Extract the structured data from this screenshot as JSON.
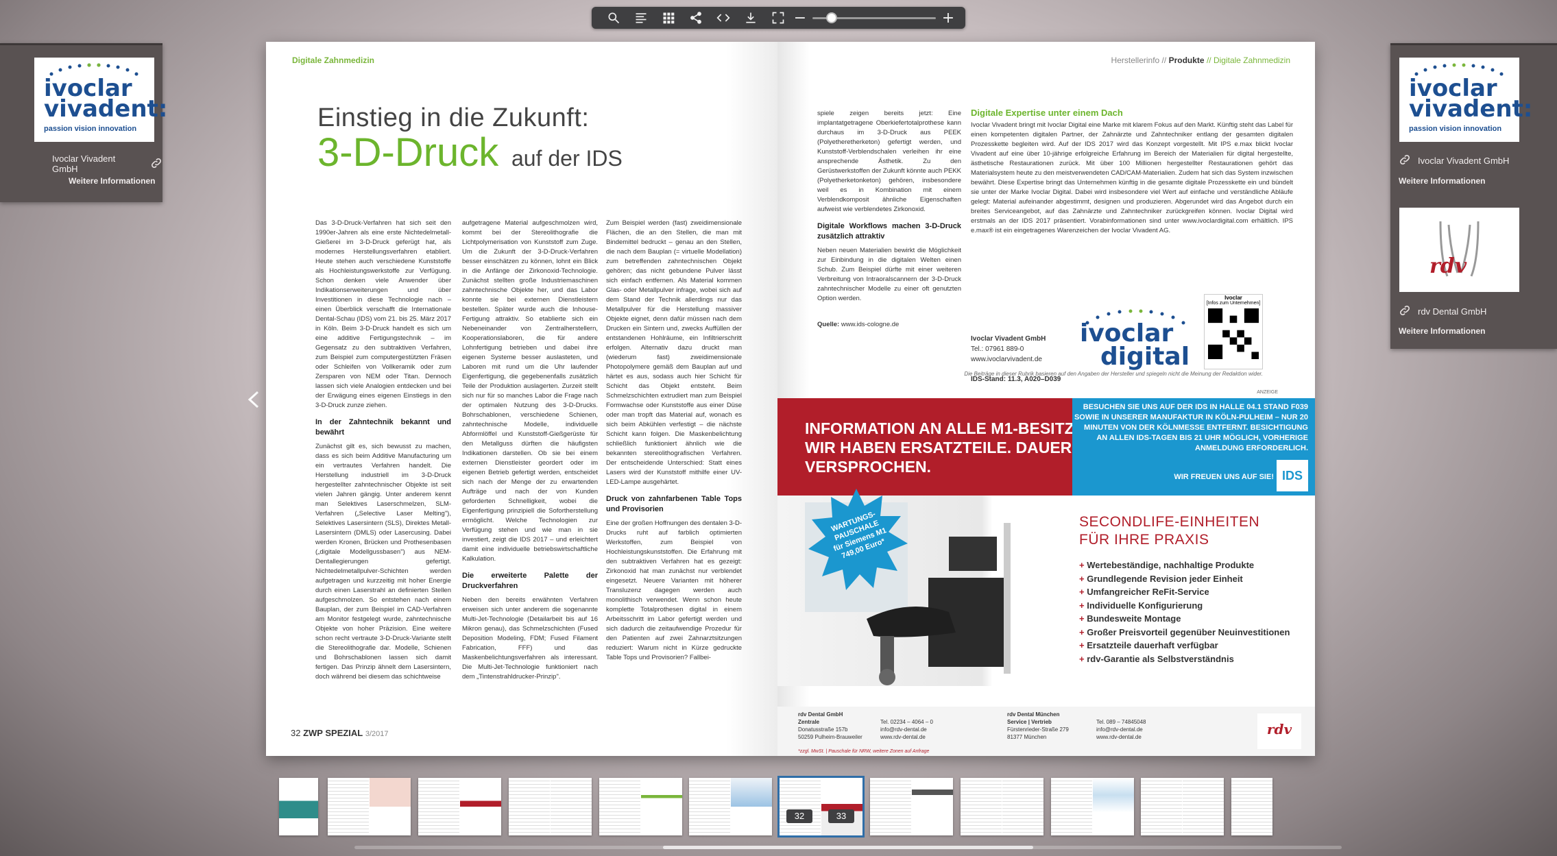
{
  "toolbar": {
    "icons": [
      "search-icon",
      "table-of-contents-icon",
      "grid-icon",
      "share-icon",
      "embed-icon",
      "download-icon",
      "fullscreen-icon"
    ],
    "zoom_minus": "−",
    "zoom_plus": "+"
  },
  "left_panel": {
    "company": "Ivoclar Vivadent GmbH",
    "more_info": "Weitere Informationen",
    "logo_line1": "ivoclar",
    "logo_line2": "vivadent:",
    "logo_tagline": "passion vision innovation"
  },
  "right_panel": {
    "items": [
      {
        "company": "Ivoclar Vivadent GmbH",
        "more_info": "Weitere Informationen",
        "logo_line1": "ivoclar",
        "logo_line2": "vivadent:",
        "logo_tagline": "passion vision innovation"
      },
      {
        "company": "rdv Dental GmbH",
        "more_info": "Weitere Informationen",
        "logo_text": "rdv"
      }
    ]
  },
  "left_page": {
    "section": "Digitale Zahnmedizin",
    "title_line1": "Einstieg in die Zukunft:",
    "title_big": "3-D-Druck",
    "title_rest": "auf der IDS",
    "col1_p1": "Das 3-D-Druck-Verfahren hat sich seit den 1990er-Jahren als eine erste Nichtedelmetall-Gießerei im 3-D-Druck geferügt hat, als modernes Herstellungsverfahren etabliert. Heute stehen auch verschiedene Kunststoffe als Hochleistungswerkstoffe zur Verfügung. Schon denken viele Anwender über Indikationserweiterungen und über Investitionen in diese Technologie nach – einen Überblick verschafft die Internationale Dental-Schau (IDS) vom 21. bis 25. März 2017 in Köln. Beim 3-D-Druck handelt es sich um eine additive Fertigungstechnik – im Gegensatz zu den subtraktiven Verfahren, zum Beispiel zum computergestützten Fräsen oder Schleifen von Vollkeramik oder zum Zersparen von NEM oder Titan. Dennoch lassen sich viele Analogien entdecken und bei der Erwägung eines eigenen Einstiegs in den 3-D-Druck zunze ziehen.",
    "col1_sub": "In der Zahntechnik bekannt und bewährt",
    "col1_p2": "Zunächst gilt es, sich bewusst zu machen, dass es sich beim Additive Manufacturing um ein vertrautes Verfahren handelt. Die Herstellung industriell im 3-D-Druck hergestellter zahntechnischer Objekte ist seit vielen Jahren gängig. Unter anderem kennt man Selektives Laserschmelzen, SLM-Verfahren („Selective Laser Melting\"), Selektives Lasersintern (SLS), Direktes Metall-Lasersintern (DMLS) oder Lasercusing. Dabei werden Kronen, Brücken und Prothesenbasen („digitale Modellgussbasen\") aus NEM-Dentallegierungen gefertigt. Nichtedelmetallpulver-Schichten werden aufgetragen und kurzzeitig mit hoher Energie durch einen Laserstrahl an definierten Stellen aufgeschmolzen. So entstehen nach einem Bauplan, der zum Beispiel im CAD-Verfahren am Monitor festgelegt wurde, zahntechnische Objekte von hoher Präzision. Eine weitere schon recht vertraute 3-D-Druck-Variante stellt die Stereolithografie dar. Modelle, Schienen und Bohrschablonen lassen sich damit fertigen. Das Prinzip ähnelt dem Lasersintern, doch während bei diesem das schichtweise",
    "col2_p1": "aufgetragene Material aufgeschmolzen wird, kommt bei der Stereolithografie die Lichtpolymerisation von Kunststoff zum Zuge. Um die Zukunft der 3-D-Druck-Verfahren besser einschätzen zu können, lohnt ein Blick in die Anfänge der Zirkonoxid-Technologie. Zunächst stellten große Industriemaschinen zahntechnische Objekte her, und das Labor konnte sie bei externen Dienstleistern bestellen. Später wurde auch die Inhouse-Fertigung attraktiv. So etablierte sich ein Nebeneinander von Zentralherstellern, Kooperationslaboren, die für andere Lohnfertigung betrieben und dabei ihre eigenen Systeme besser auslasteten, und Laboren mit rund um die Uhr laufender Eigenfertigung, die gegebenenfalls zusätzlich Teile der Produktion auslagerten. Zurzeit stellt sich nur für so manches Labor die Frage nach der optimalen Nutzung des 3-D-Drucks. Bohrschablonen, verschiedene Schienen, zahntechnische Modelle, individuelle Abformlöffel und Kunststoff-Gießgerüste für den Metallguss dürften die häufigsten Indikationen darstellen. Ob sie bei einem externen Dienstleister geordert oder im eigenen Betrieb gefertigt werden, entscheidet sich nach der Menge der zu erwartenden Aufträge und nach der von Kunden geforderten Schnelligkeit, wobei die Eigenfertigung prinzipiell die Sofortherstellung ermöglicht. Welche Technologien zur Verfügung stehen und wie man in sie investiert, zeigt die IDS 2017 – und erleichtert damit eine individuelle betriebswirtschaftliche Kalkulation.",
    "col2_sub": "Die erweiterte Palette der Druckverfahren",
    "col2_p2": "Neben den bereits erwähnten Verfahren erweisen sich unter anderem die sogenannte Multi-Jet-Technologie (Detailarbeit bis auf 16 Mikron genau), das Schmelzschichten (Fused Deposition Modeling, FDM; Fused Filament Fabrication, FFF) und das Maskenbelichtungsverfahren als interessant. Die Multi-Jet-Technologie funktioniert nach dem „Tintenstrahldrucker-Prinzip\".",
    "col3_p1": "Zum Beispiel werden (fast) zweidimensionale Flächen, die an den Stellen, die man mit Bindemittel bedruckt – genau an den Stellen, die nach dem Bauplan (= virtuelle Modellation) zum betreffenden zahntechnischen Objekt gehören; das nicht gebundene Pulver lässt sich einfach entfernen. Als Material kommen Glas- oder Metallpulver infrage, wobei sich auf dem Stand der Technik allerdings nur das Metallpulver für die Herstellung massiver Objekte eignet, denn dafür müssen nach dem Drucken ein Sintern und, zwecks Auffüllen der entstandenen Hohlräume, ein Infiltrierschritt erfolgen. Alternativ dazu druckt man (wiederum fast) zweidimensionale Photopolymere gemäß dem Bauplan auf und härtet es aus, sodass auch hier Schicht für Schicht das Objekt entsteht. Beim Schmelzschichten extrudiert man zum Beispiel Formwachse oder Kunststoffe aus einer Düse oder man tropft das Material auf, wonach es sich beim Abkühlen verfestigt – die nächste Schicht kann folgen. Die Maskenbelichtung schließlich funktioniert ähnlich wie die bekannten stereolithografischen Verfahren. Der entscheidende Unterschied: Statt eines Lasers wird der Kunststoff mithilfe einer UV-LED-Lampe ausgehärtet.",
    "col3_sub": "Druck von zahnfarbenen Table Tops und Provisorien",
    "col3_p2": "Eine der großen Hoffnungen des dentalen 3-D-Drucks ruht auf farblich optimierten Werkstoffen, zum Beispiel von Hochleistungskunststoffen. Die Erfahrung mit den subtraktiven Verfahren hat es gezeigt: Zirkonoxid hat man zunächst nur verblendet eingesetzt. Neuere Varianten mit höherer Transluzenz dagegen werden auch monolithisch verwendet. Wenn schon heute komplette Totalprothesen digital in einem Arbeitsschritt im Labor gefertigt werden und sich dadurch die zeitaufwendige Prozedur für den Patienten auf zwei Zahnarztsitzungen reduziert: Warum nicht in Kürze gedruckte Table Tops und Provisorien? Fallbei-",
    "footer_page": "32",
    "footer_mag": "ZWP SPEZIAL",
    "footer_issue": "3/2017"
  },
  "right_page": {
    "header_pre": "Herstellerinfo //",
    "header_bold": "Produkte",
    "header_post": "// Digitale Zahnmedizin",
    "col1_p1": "spiele zeigen bereits jetzt: Eine implantatgetragene Oberkiefertotalprothese kann durchaus im 3-D-Druck aus PEEK (Polyetheretherketon) gefertigt werden, und Kunststoff-Verblendschalen verleihen ihr eine ansprechende Ästhetik. Zu den Gerüstwerkstoffen der Zukunft könnte auch PEKK (Polyetherketonketon) gehören, insbesondere weil es in Kombination mit einem Verblendkomposit ähnliche Eigenschaften aufweist wie verblendetes Zirkonoxid.",
    "col1_sub": "Digitale Workflows machen 3-D-Druck zusätzlich attraktiv",
    "col1_p2": "Neben neuen Materialien bewirkt die Möglichkeit zur Einbindung in die digitalen Welten einen Schub. Zum Beispiel dürfte mit einer weiteren Verbreitung von Intraoralscannern der 3-D-Druck zahntechnischer Modelle zu einer oft genutzten Option werden.",
    "source_label": "Quelle:",
    "source": "www.ids-cologne.de",
    "box_title": "Digitale Expertise unter einem Dach",
    "box_p": "Ivoclar Vivadent bringt mit Ivoclar Digital eine Marke mit klarem Fokus auf den Markt. Künftig steht das Label für einen kompetenten digitalen Partner, der Zahnärzte und Zahntechniker entlang der gesamten digitalen Prozesskette begleiten wird. Auf der IDS 2017 wird das Konzept vorgestellt. Mit IPS e.max blickt Ivoclar Vivadent auf eine über 10-jährige erfolgreiche Erfahrung im Bereich der Materialien für digital hergestellte, ästhetische Restaurationen zurück. Mit über 100 Millionen hergestellter Restaurationen gehört das Materialsystem heute zu den meistverwendeten CAD/CAM-Materialien. Zudem hat sich das System inzwischen bewährt. Diese Expertise bringt das Unternehmen künftig in die gesamte digitale Prozesskette ein und bündelt sie unter der Marke Ivoclar Digital. Dabei wird insbesondere viel Wert auf einfache und verständliche Abläufe gelegt: Material aufeinander abgestimmt, designen und produzieren. Abgerundet wird das Angebot durch ein breites Serviceangebot, auf das Zahnärzte und Zahntechniker zurückgreifen können. Ivoclar Digital wird erstmals an der IDS 2017 präsentiert. Vorabinformationen sind unter www.ivoclardigital.com erhältlich. IPS e.max® ist ein eingetragenes Warenzeichen der Ivoclar Vivadent AG.",
    "contact_name": "Ivoclar Vivadent GmbH",
    "contact_tel": "Tel.: 07961 889-0",
    "contact_web": "www.ivoclarvivadent.de",
    "contact_stand": "IDS-Stand: 11.3, A020–D039",
    "digital_logo_1": "ivoclar",
    "digital_logo_2": "digital",
    "qr_title": "Ivoclar",
    "qr_sub": "[Infos zum Unternehmen]",
    "disclaimer": "Die Beiträge in dieser Rubrik basieren auf den Angaben der Hersteller und spiegeln nicht die Meinung der Redaktion wider.",
    "anzeige": "ANZEIGE",
    "ad_headline_1": "INFORMATION AN ALLE M1-BESITZER:",
    "ad_headline_2": "WIR HABEN ERSATZTEILE. DAUERHAFT.",
    "ad_headline_3": "VERSPROCHEN.",
    "ad_blue_text": "BESUCHEN SIE UNS AUF DER IDS IN HALLE 04.1 STAND F039 SOWIE IN UNSERER MANUFAKTUR IN KÖLN-PULHEIM – NUR 20 MINUTEN VON DER KÖLNMESSE ENTFERNT. BESICHTIGUNG AN ALLEN IDS-TAGEN BIS 21 UHR MÖGLICH, VORHERIGE ANMELDUNG ERFORDERLICH.",
    "ad_blue_cta": "WIR FREUEN UNS AUF SIE!",
    "ids_logo": "IDS",
    "starburst": [
      "WARTUNGS-",
      "PAUSCHALE",
      "für Siemens M1",
      "749,00 Euro*"
    ],
    "ad_title_1": "SECONDLIFE-EINHEITEN",
    "ad_title_2": "FÜR IHRE PRAXIS",
    "ad_bullets": [
      "Wertebeständige, nachhaltige Produkte",
      "Grundlegende Revision jeder Einheit",
      "Umfangreicher ReFit-Service",
      "Individuelle Konfigurierung",
      "Bundesweite Montage",
      "Großer Preisvorteil gegenüber Neuinvestitionen",
      "Ersatzteile dauerhaft verfügbar",
      "rdv-Garantie als Selbstverständnis"
    ],
    "foot_c1": [
      "rdv Dental GmbH",
      "Zentrale",
      "Donatusstraße 157b",
      "50259 Pulheim-Brauweiler"
    ],
    "foot_c2": [
      "Tel. 02234 – 4064 – 0",
      "info@rdv-dental.de",
      "www.rdv-dental.de"
    ],
    "foot_c3": [
      "rdv Dental München",
      "Service | Vertrieb",
      "Fürstenrieder-Straße 279",
      "81377 München"
    ],
    "foot_c4": [
      "Tel. 089 – 74845048",
      "info@rdv-dental.de",
      "www.rdv-dental.de"
    ],
    "foot_note": "*zzgl. MwSt. | Pauschale für NRW, weitere Zonen auf Anfrage",
    "rdv_logo": "rdv"
  },
  "filmstrip": {
    "selected_left": "32",
    "selected_right": "33"
  },
  "colors": {
    "green": "#6cb52d",
    "ivoclar_blue": "#1d4f91",
    "rdv_red": "#b11e2a",
    "ids_blue": "#1b97cf"
  }
}
